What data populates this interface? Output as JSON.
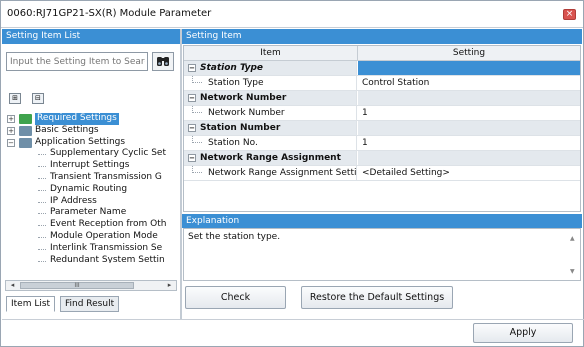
{
  "window": {
    "title": "0060:RJ71GP21-SX(R) Module Parameter",
    "close_glyph": "×"
  },
  "left_panel": {
    "header": "Setting Item List",
    "search_placeholder": "Input the Setting Item to Search",
    "search_icon": "binoculars-icon",
    "tool_icons": [
      "expand-all-icon",
      "collapse-all-icon"
    ],
    "tree": [
      {
        "label": "Required Settings",
        "level": 1,
        "expander": "+",
        "icon": "check-folder-icon",
        "selected": true
      },
      {
        "label": "Basic Settings",
        "level": 1,
        "expander": "+",
        "icon": "folder-icon",
        "selected": false
      },
      {
        "label": "Application Settings",
        "level": 1,
        "expander": "−",
        "icon": "folder-icon",
        "selected": false
      },
      {
        "label": "Supplementary Cyclic Set",
        "level": 2
      },
      {
        "label": "Interrupt Settings",
        "level": 2
      },
      {
        "label": "Transient Transmission G",
        "level": 2
      },
      {
        "label": "Dynamic Routing",
        "level": 2
      },
      {
        "label": "IP Address",
        "level": 2
      },
      {
        "label": "Parameter Name",
        "level": 2
      },
      {
        "label": "Event Reception from Oth",
        "level": 2
      },
      {
        "label": "Module Operation Mode",
        "level": 2
      },
      {
        "label": "Interlink Transmission Se",
        "level": 2
      },
      {
        "label": "Redundant System Settin",
        "level": 2
      }
    ],
    "scroll_left": "◂",
    "scroll_right": "▸",
    "scroll_thumb": "III",
    "tabs": [
      "Item List",
      "Find Result"
    ]
  },
  "right_panel": {
    "header": "Setting Item",
    "columns": [
      "Item",
      "Setting"
    ],
    "rows": [
      {
        "type": "group",
        "item": "Station Type",
        "setting": "",
        "italic": true
      },
      {
        "type": "item",
        "item": "Station Type",
        "setting": "Control Station"
      },
      {
        "type": "group",
        "item": "Network Number",
        "setting": ""
      },
      {
        "type": "item",
        "item": "Network Number",
        "setting": "1"
      },
      {
        "type": "group",
        "item": "Station Number",
        "setting": ""
      },
      {
        "type": "item",
        "item": "Station No.",
        "setting": "1"
      },
      {
        "type": "group",
        "item": "Network Range Assignment",
        "setting": ""
      },
      {
        "type": "item",
        "item": "Network Range Assignment Setting",
        "setting": "<Detailed Setting>"
      }
    ],
    "explanation_header": "Explanation",
    "explanation_text": "Set the station type.",
    "buttons": {
      "check": "Check",
      "restore": "Restore the Default Settings",
      "apply": "Apply"
    }
  },
  "colors": {
    "accent": "#3b8fd4",
    "close": "#d9534f"
  }
}
